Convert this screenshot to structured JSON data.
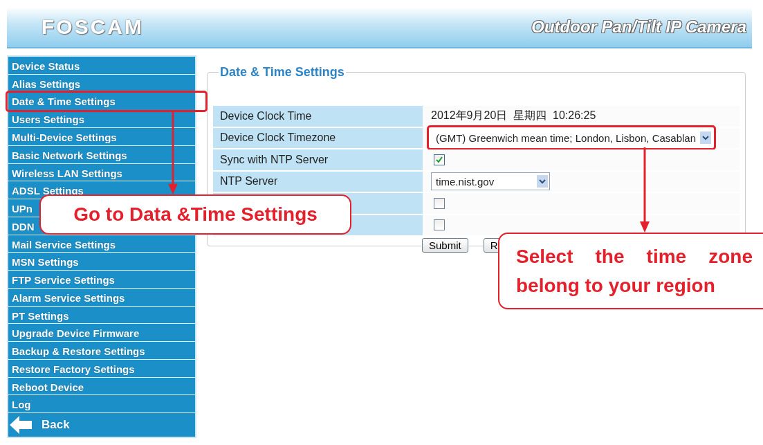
{
  "header": {
    "logo": "FOSCAM",
    "product": "Outdoor Pan/Tilt IP Camera"
  },
  "sidebar": {
    "items": [
      {
        "label": "Device Status",
        "highlighted": false
      },
      {
        "label": "Alias Settings",
        "highlighted": false
      },
      {
        "label": "Date & Time Settings",
        "highlighted": true
      },
      {
        "label": "Users Settings",
        "highlighted": false
      },
      {
        "label": "Multi-Device Settings",
        "highlighted": false
      },
      {
        "label": "Basic Network Settings",
        "highlighted": false
      },
      {
        "label": "Wireless LAN Settings",
        "highlighted": false
      },
      {
        "label": "ADSL Settings",
        "highlighted": false
      },
      {
        "label": "UPn",
        "highlighted": false
      },
      {
        "label": "DDN",
        "highlighted": false
      },
      {
        "label": "Mail Service Settings",
        "highlighted": false
      },
      {
        "label": "MSN Settings",
        "highlighted": false
      },
      {
        "label": "FTP Service Settings",
        "highlighted": false
      },
      {
        "label": "Alarm Service Settings",
        "highlighted": false
      },
      {
        "label": "PT Settings",
        "highlighted": false
      },
      {
        "label": "Upgrade Device Firmware",
        "highlighted": false
      },
      {
        "label": "Backup & Restore Settings",
        "highlighted": false
      },
      {
        "label": "Restore Factory Settings",
        "highlighted": false
      },
      {
        "label": "Reboot Device",
        "highlighted": false
      },
      {
        "label": "Log",
        "highlighted": false
      }
    ],
    "back": "Back"
  },
  "panel": {
    "title": "Date & Time Settings",
    "rows": [
      {
        "kind": "text",
        "label": "Device Clock Time",
        "value": "2012年9月20日  星期四  10:26:25"
      },
      {
        "kind": "select",
        "label": "Device Clock Timezone",
        "value": "(GMT) Greenwich mean time; London, Lisbon, Casablan",
        "highlighted": true
      },
      {
        "kind": "checkbox",
        "label": "Sync with NTP Server",
        "checked": true
      },
      {
        "kind": "select",
        "label": "NTP Server",
        "value": "time.nist.gov",
        "highlighted": false
      },
      {
        "kind": "checkbox",
        "checked": false
      },
      {
        "kind": "checkbox",
        "checked": false
      }
    ],
    "buttons": [
      "Submit",
      "R"
    ]
  },
  "annotations": [
    {
      "text": "Go to Data &Time Settings"
    },
    {
      "text": "Select the time zone belong to your region"
    }
  ]
}
